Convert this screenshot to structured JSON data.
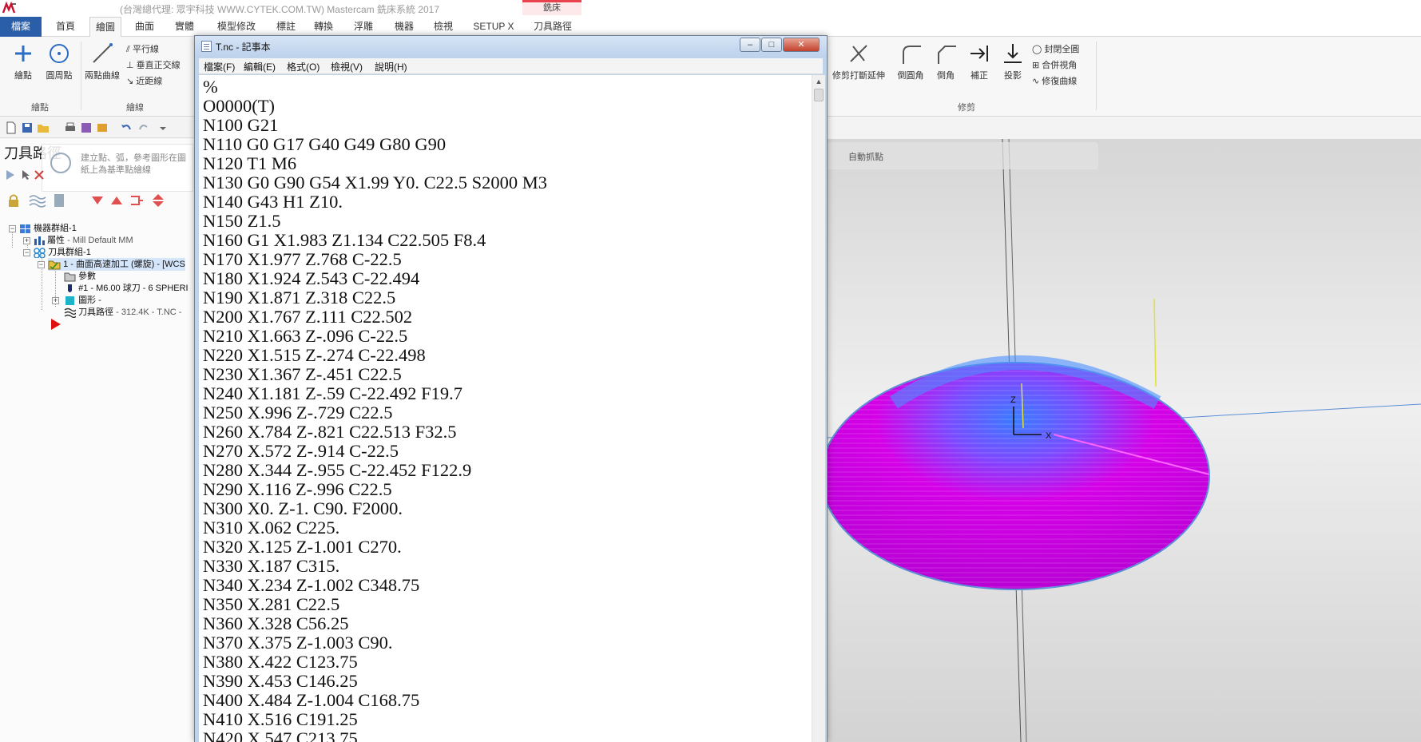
{
  "app": {
    "title": "(台灣總代理: 眾宇科技 WWW.CYTEK.COM.TW) Mastercam 銑床系統 2017",
    "context_tab_header": "銑床",
    "tabs": [
      {
        "label": "檔案",
        "kind": "file"
      },
      {
        "label": "首頁",
        "kind": "normal"
      },
      {
        "label": "繪圖",
        "kind": "active"
      },
      {
        "label": "曲面",
        "kind": "normal"
      },
      {
        "label": "實體",
        "kind": "normal"
      },
      {
        "label": "模型修改",
        "kind": "normal"
      },
      {
        "label": "標註",
        "kind": "normal"
      },
      {
        "label": "轉換",
        "kind": "normal"
      },
      {
        "label": "浮雕",
        "kind": "normal"
      },
      {
        "label": "機器",
        "kind": "normal"
      },
      {
        "label": "檢視",
        "kind": "normal"
      },
      {
        "label": "SETUP X",
        "kind": "normal"
      },
      {
        "label": "刀具路徑",
        "kind": "context"
      }
    ]
  },
  "ribbon": {
    "points_group": {
      "label": "繪點",
      "btn_point": "繪點",
      "btn_circle_point": "圓周點"
    },
    "lines_group": {
      "label": "繪線",
      "btn_two_curves": "兩點曲線",
      "parallel": "平行線",
      "perpendicular": "垂直正交線",
      "closest": "近距線"
    },
    "trim_group": {
      "label": "修剪",
      "btn_trim_break_extend": "修剪打斷延伸",
      "btn_fillet": "倒圓角",
      "btn_chamfer": "倒角",
      "btn_offset": "補正",
      "btn_project": "投影",
      "close_arc": "封閉全圓",
      "join_entities": "合併視角",
      "modify_curve": "修復曲線"
    }
  },
  "panel": {
    "title": "刀具路徑",
    "tooltip_text": "建立點、弧，參考圖形在圖紙上為基準點繪線",
    "tree": {
      "machine_group": "機器群組-1",
      "properties": "屬性",
      "properties_detail": "- Mill Default MM",
      "toolpath_group": "刀具群組-1",
      "operation": "1 - 曲面高速加工 (螺旋) - [WCS",
      "params": "參數",
      "tool": "#1 - M6.00 球刀 - 6 SPHERI",
      "geometry": "圖形 -",
      "toolpath": "刀具路徑",
      "toolpath_detail": "- 312.4K - T.NC - "
    }
  },
  "viewport": {
    "toolbar_label": "自動抓點",
    "axis_z": "Z",
    "axis_x": "X",
    "colors": {
      "dome_fill": "#d400e6",
      "dome_top": "#3a7cff",
      "outline": "#5a8fd6"
    }
  },
  "notepad": {
    "title": "T.nc - 記事本",
    "btn_minimize": "–",
    "btn_maximize": "□",
    "btn_close": "✕",
    "menus": [
      "檔案(F)",
      "編輯(E)",
      "格式(O)",
      "檢視(V)",
      "說明(H)"
    ],
    "lines": [
      "%",
      "O0000(T)",
      "N100 G21",
      "N110 G0 G17 G40 G49 G80 G90",
      "N120 T1 M6",
      "N130 G0 G90 G54 X1.99 Y0. C22.5 S2000 M3",
      "N140 G43 H1 Z10.",
      "N150 Z1.5",
      "N160 G1 X1.983 Z1.134 C22.505 F8.4",
      "N170 X1.977 Z.768 C-22.5",
      "N180 X1.924 Z.543 C-22.494",
      "N190 X1.871 Z.318 C22.5",
      "N200 X1.767 Z.111 C22.502",
      "N210 X1.663 Z-.096 C-22.5",
      "N220 X1.515 Z-.274 C-22.498",
      "N230 X1.367 Z-.451 C22.5",
      "N240 X1.181 Z-.59 C-22.492 F19.7",
      "N250 X.996 Z-.729 C22.5",
      "N260 X.784 Z-.821 C22.513 F32.5",
      "N270 X.572 Z-.914 C-22.5",
      "N280 X.344 Z-.955 C-22.452 F122.9",
      "N290 X.116 Z-.996 C22.5",
      "N300 X0. Z-1. C90. F2000.",
      "N310 X.062 C225.",
      "N320 X.125 Z-1.001 C270.",
      "N330 X.187 C315.",
      "N340 X.234 Z-1.002 C348.75",
      "N350 X.281 C22.5",
      "N360 X.328 C56.25",
      "N370 X.375 Z-1.003 C90.",
      "N380 X.422 C123.75",
      "N390 X.453 C146.25",
      "N400 X.484 Z-1.004 C168.75",
      "N410 X.516 C191.25",
      "N420 X.547 C213.75"
    ]
  }
}
